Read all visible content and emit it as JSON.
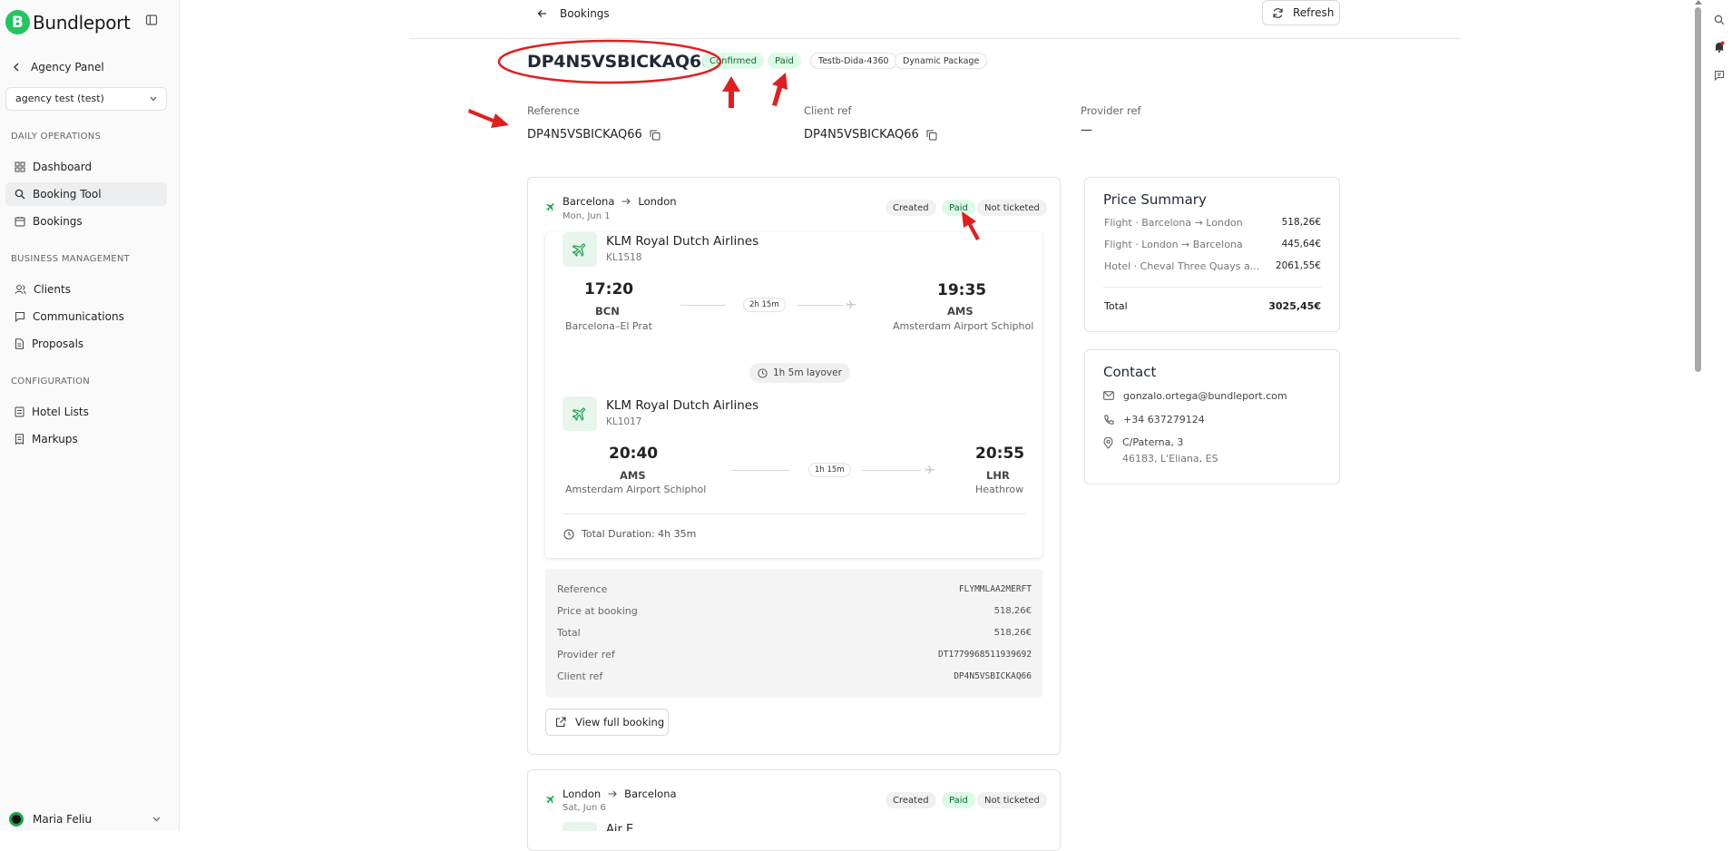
{
  "app": {
    "logo_letter": "B",
    "logo_text": "Bundleport"
  },
  "sidebar": {
    "agency_back_label": "Agency Panel",
    "agency_select_value": "agency test (test)",
    "sections": [
      "DAILY OPERATIONS",
      "BUSINESS MANAGEMENT",
      "CONFIGURATION"
    ],
    "items": [
      {
        "label": "Dashboard",
        "icon": "dashboard-icon"
      },
      {
        "label": "Booking Tool",
        "icon": "search-icon",
        "active": true
      },
      {
        "label": "Bookings",
        "icon": "calendar-icon"
      },
      {
        "label": "Clients",
        "icon": "users-icon"
      },
      {
        "label": "Communications",
        "icon": "message-icon"
      },
      {
        "label": "Proposals",
        "icon": "document-icon"
      },
      {
        "label": "Hotel Lists",
        "icon": "list-icon"
      },
      {
        "label": "Markups",
        "icon": "receipt-icon"
      }
    ],
    "user_name": "Maria Feliu"
  },
  "header": {
    "back_label": "Bookings",
    "refresh_label": "Refresh"
  },
  "booking": {
    "title": "DP4N5VSBICKAQ66",
    "badges": [
      "Confirmed",
      "Paid",
      "Testb-Dida-4360",
      "Dynamic Package"
    ],
    "reference_label": "Reference",
    "reference_value": "DP4N5VSBICKAQ66",
    "client_ref_label": "Client ref",
    "client_ref_value": "DP4N5VSBICKAQ66",
    "provider_ref_label": "Provider ref",
    "provider_ref_value": "—"
  },
  "flight1": {
    "from": "Barcelona",
    "to": "London",
    "date": "Mon, Jun 1",
    "statuses": [
      "Created",
      "Paid",
      "Not ticketed"
    ],
    "segments": [
      {
        "airline": "KLM Royal Dutch Airlines",
        "flight_no": "KL1518",
        "dep_time": "17:20",
        "dep_code": "BCN",
        "dep_airport": "Barcelona–El Prat",
        "duration": "2h 15m",
        "arr_time": "19:35",
        "arr_code": "AMS",
        "arr_airport": "Amsterdam Airport Schiphol"
      },
      {
        "airline": "KLM Royal Dutch Airlines",
        "flight_no": "KL1017",
        "dep_time": "20:40",
        "dep_code": "AMS",
        "dep_airport": "Amsterdam Airport Schiphol",
        "duration": "1h 15m",
        "arr_time": "20:55",
        "arr_code": "LHR",
        "arr_airport": "Heathrow"
      }
    ],
    "layover": "1h 5m layover",
    "total_duration": "Total Duration: 4h 35m",
    "details": [
      {
        "label": "Reference",
        "value": "FLYMMLAA2MERFT"
      },
      {
        "label": "Price at booking",
        "value": "518,26€"
      },
      {
        "label": "Total",
        "value": "518,26€"
      },
      {
        "label": "Provider ref",
        "value": "DT1779968511939692"
      },
      {
        "label": "Client ref",
        "value": "DP4N5VSBICKAQ66"
      }
    ],
    "view_label": "View full booking"
  },
  "flight2": {
    "from": "London",
    "to": "Barcelona",
    "date": "Sat, Jun 6",
    "statuses": [
      "Created",
      "Paid",
      "Not ticketed"
    ],
    "airline_partial": "Air E..."
  },
  "price_summary": {
    "title": "Price Summary",
    "rows": [
      {
        "type": "Flight",
        "desc": "Barcelona → London",
        "amount": "518,26€"
      },
      {
        "type": "Flight",
        "desc": "London → Barcelona",
        "amount": "445,64€"
      },
      {
        "type": "Hotel",
        "desc": "Cheval Three Quays a...",
        "amount": "2061,55€"
      }
    ],
    "total_label": "Total",
    "total_amount": "3025,45€"
  },
  "contact": {
    "title": "Contact",
    "email": "gonzalo.ortega@bundleport.com",
    "phone": "+34 637279124",
    "address_line1": "C/Paterna, 3",
    "address_line2": "46183, L'Eliana, ES"
  },
  "colors": {
    "brand": "#22c55e",
    "annotation": "#e02020",
    "paid_bg": "#dcfce7"
  }
}
